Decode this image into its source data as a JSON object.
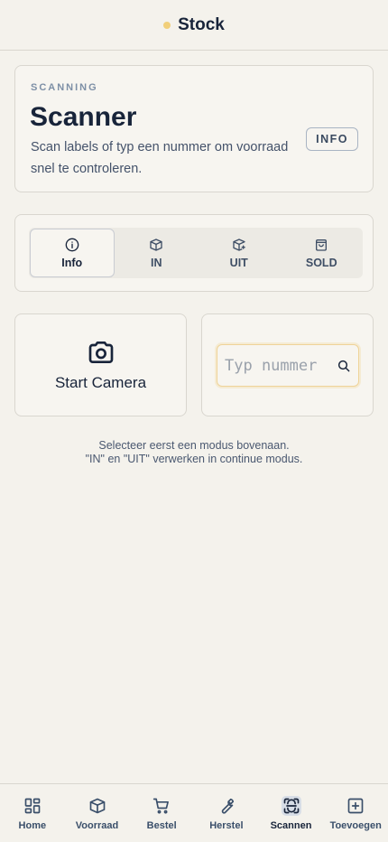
{
  "header": {
    "title": "Stock"
  },
  "intro": {
    "eyebrow": "SCANNING",
    "heading": "Scanner",
    "description": "Scan labels of typ een nummer om voorraad snel te controleren.",
    "info_button": "INFO"
  },
  "modes": {
    "tabs": [
      {
        "label": "Info",
        "icon": "info-icon",
        "active": true
      },
      {
        "label": "IN",
        "icon": "box-in-icon",
        "active": false
      },
      {
        "label": "UIT",
        "icon": "box-out-icon",
        "active": false
      },
      {
        "label": "SOLD",
        "icon": "bag-icon",
        "active": false
      }
    ]
  },
  "camera": {
    "label": "Start Camera",
    "icon": "camera-icon"
  },
  "manual": {
    "placeholder": "Typ nummer",
    "value": ""
  },
  "hint": {
    "line1": "Selecteer eerst een modus bovenaan.",
    "line2": "\"IN\" en \"UIT\" verwerken in continue modus."
  },
  "nav": {
    "items": [
      {
        "label": "Home",
        "icon": "grid-icon"
      },
      {
        "label": "Voorraad",
        "icon": "box-icon"
      },
      {
        "label": "Bestel",
        "icon": "cart-icon"
      },
      {
        "label": "Herstel",
        "icon": "wrench-icon"
      },
      {
        "label": "Scannen",
        "icon": "scan-icon",
        "active": true
      },
      {
        "label": "Toevoegen",
        "icon": "plus-square-icon"
      }
    ]
  },
  "colors": {
    "background": "#f4f2ec",
    "accent_dot": "#f1cf7a",
    "text_dark": "#18243a",
    "active_nav_bg": "#d7dde6"
  }
}
